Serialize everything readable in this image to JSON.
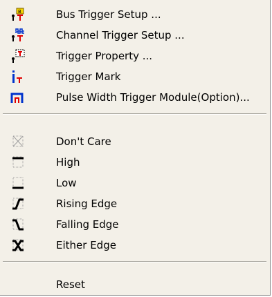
{
  "menu": {
    "items": [
      {
        "label": "Bus Trigger Setup ...",
        "icon": "bus-trigger-icon"
      },
      {
        "label": "Channel Trigger Setup ...",
        "icon": "channel-trigger-icon"
      },
      {
        "label": "Trigger Property ...",
        "icon": "trigger-property-icon"
      },
      {
        "label": "Trigger Mark",
        "icon": "trigger-mark-icon"
      },
      {
        "label": "Pulse Width Trigger Module(Option)...",
        "icon": "pulse-width-icon"
      },
      {
        "label": "Don't Care",
        "icon": "dont-care-icon"
      },
      {
        "label": "High",
        "icon": "high-level-icon"
      },
      {
        "label": "Low",
        "icon": "low-level-icon"
      },
      {
        "label": "Rising Edge",
        "icon": "rising-edge-icon"
      },
      {
        "label": "Falling Edge",
        "icon": "falling-edge-icon"
      },
      {
        "label": "Either Edge",
        "icon": "either-edge-icon"
      },
      {
        "label": "Reset",
        "icon": ""
      }
    ]
  },
  "colors": {
    "menu_background": "#f3f0e8",
    "accent_blue": "#0033cc",
    "accent_red": "#e00000"
  }
}
